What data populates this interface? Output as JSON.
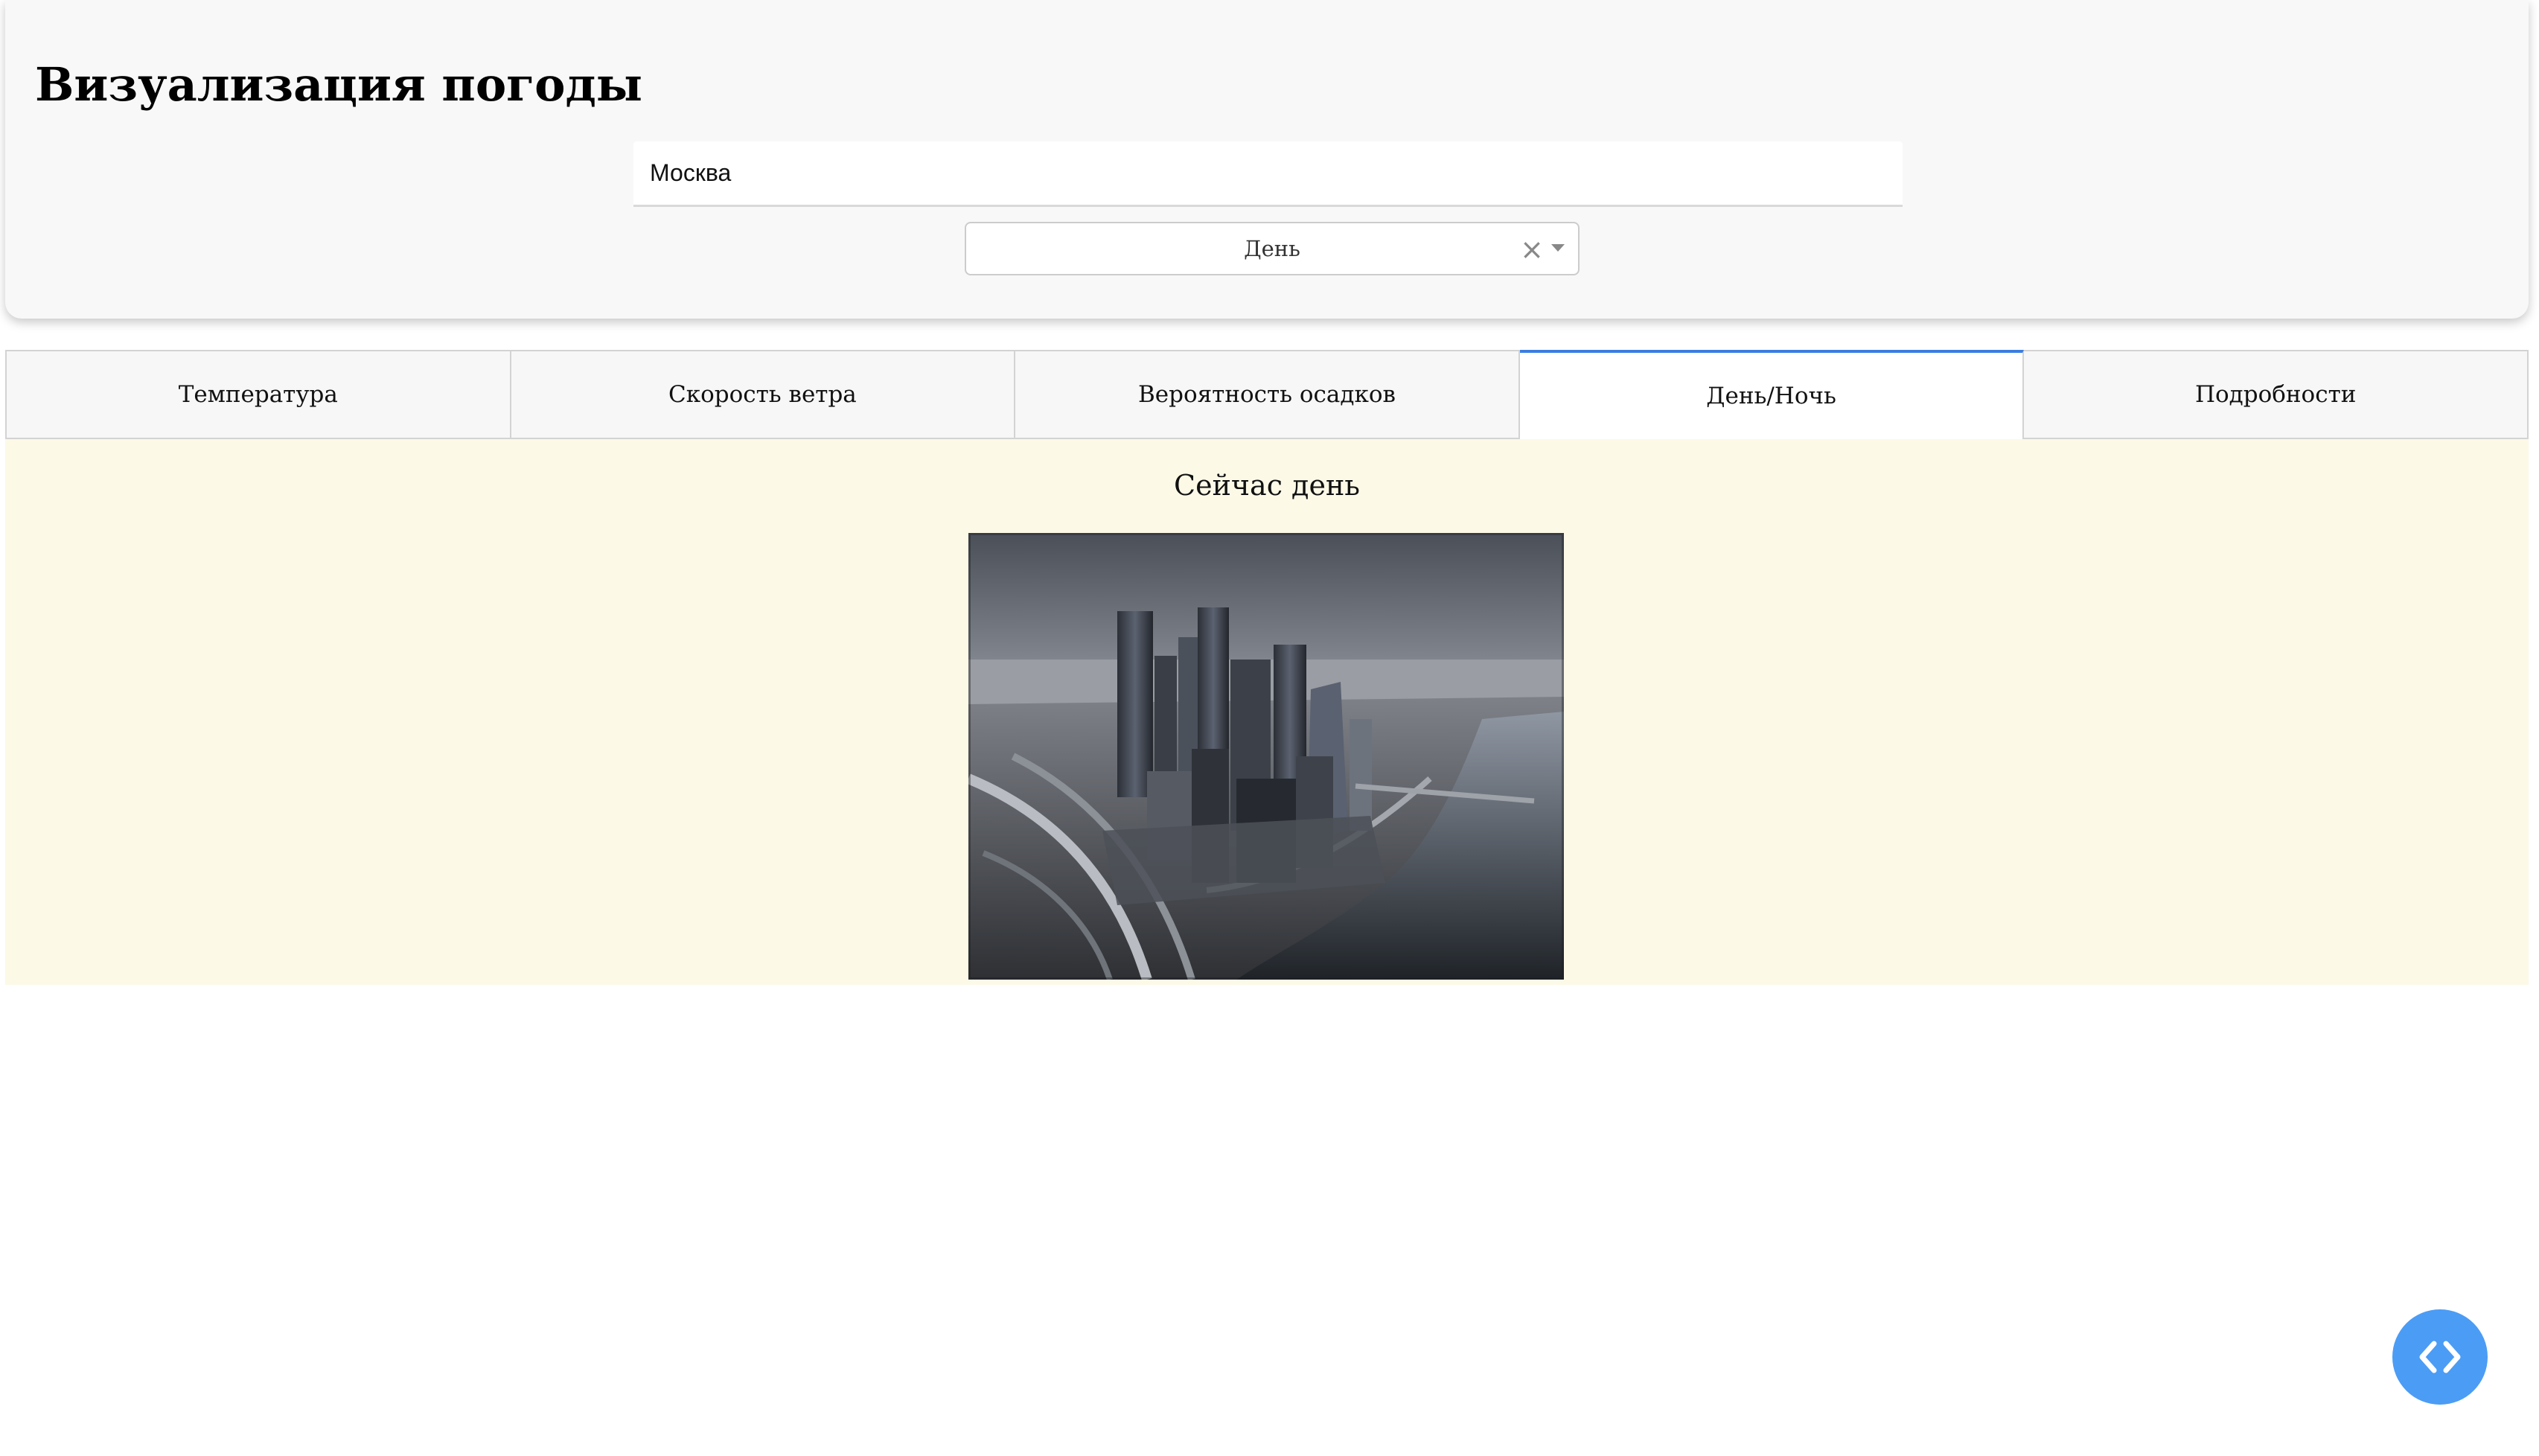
{
  "app": {
    "title": "Визуализация погоды"
  },
  "search": {
    "value": "Москва"
  },
  "time_select": {
    "value": "День",
    "clear_icon": "×",
    "icon": "chevron-down-icon"
  },
  "tabs": [
    {
      "label": "Температура",
      "active": false
    },
    {
      "label": "Скорость ветра",
      "active": false
    },
    {
      "label": "Вероятность осадков",
      "active": false
    },
    {
      "label": "День/Ночь",
      "active": true
    },
    {
      "label": "Подробности",
      "active": false
    }
  ],
  "content": {
    "status_text": "Сейчас день",
    "image_semantic": "moscow-city-skyline-photo"
  },
  "fab": {
    "icon": "code-icon"
  },
  "colors": {
    "accent": "#3b7de0",
    "fab": "#4b9cf5",
    "panel_bg": "#fcf9e7",
    "header_bg": "#f8f8f8"
  }
}
